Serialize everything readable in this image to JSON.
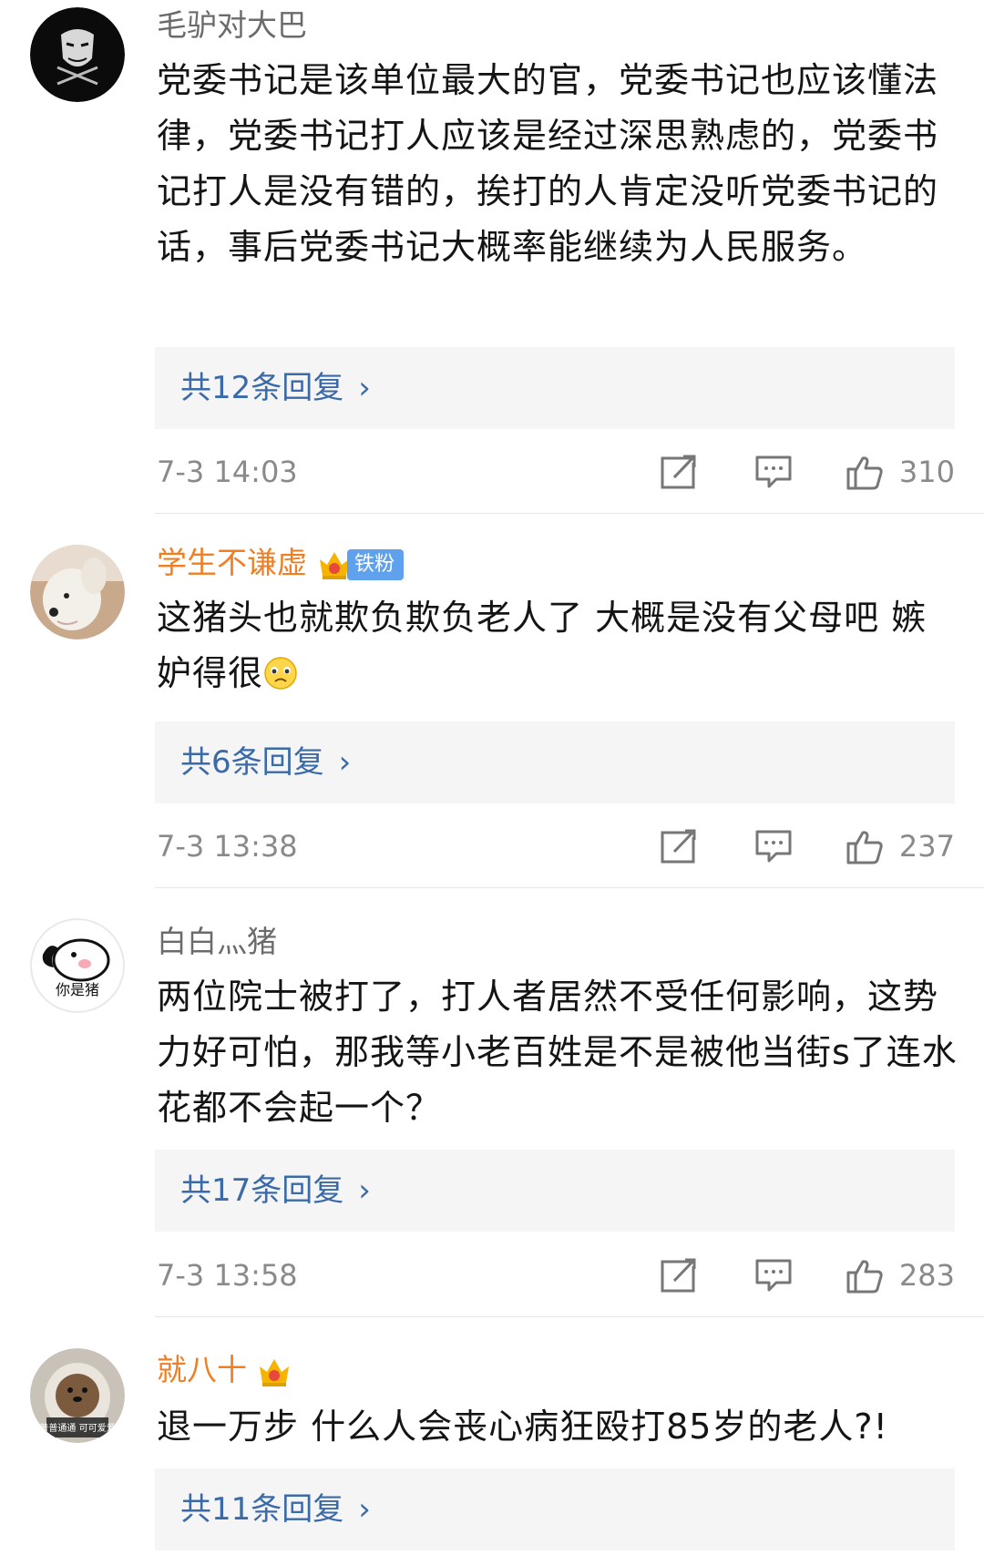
{
  "comments": [
    {
      "username": "毛驴对大巴",
      "text": "党委书记是该单位最大的官，党委书记也应该懂法律，党委书记打人应该是经过深思熟虑的，党委书记打人是没有错的，挨打的人肯定没听党委书记的话，事后党委书记大概率能继续为人民服务。",
      "replies": "共12条回复",
      "time": "7-3 14:03",
      "likes": "310"
    },
    {
      "username": "学生不谦虚",
      "badge": "铁粉",
      "text": "这猪头也就欺负欺负老人了 大概是没有父母吧 嫉妒得很",
      "replies": "共6条回复",
      "time": "7-3 13:38",
      "likes": "237"
    },
    {
      "username": "白白灬猪",
      "avatar_caption": "你是猪",
      "text": "两位院士被打了，打人者居然不受任何影响，这势力好可怕，那我等小老百姓是不是被他当街s了连水花都不会起一个？",
      "replies": "共17条回复",
      "time": "7-3 13:58",
      "likes": "283"
    },
    {
      "username": "就八十",
      "avatar_caption": "普普通通 可可爱爱",
      "text": "退一万步 什么人会丧心病狂殴打85岁的老人?!",
      "replies": "共11条回复"
    }
  ],
  "icons": {
    "share": "share-icon",
    "comment": "comment-icon",
    "like": "thumbs-up-icon",
    "chevron": "›"
  },
  "colors": {
    "vip_name": "#f07e22",
    "link": "#3b6aa8",
    "badge": "#5fa1ec"
  }
}
